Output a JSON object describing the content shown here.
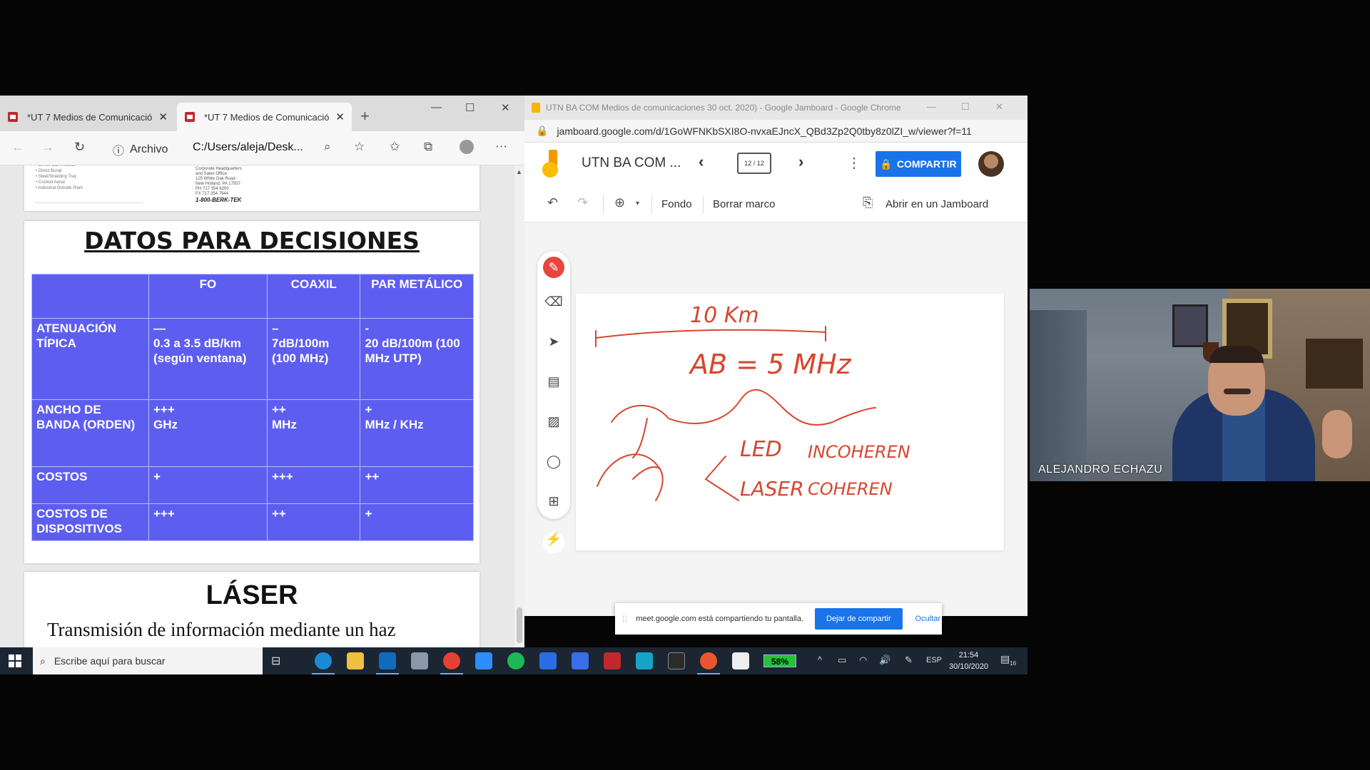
{
  "edge": {
    "tabs": [
      {
        "label": "*UT 7 Medios de Comunicación"
      },
      {
        "label": "*UT 7 Medios de Comunicación"
      }
    ],
    "address_info": "Archivo",
    "address_url": "C:/Users/aleja/Desk...",
    "prev_page": {
      "bullets": "• Dense Ball Modular\n• Direct Burial\n• Steel/Shielding Tray\n• Cocked Aerial\n• Industrial Outside Plant",
      "address": "Corporate Headquarters\nand Sales Office\n125 White Oak Road\nNew Holland, PA 17557\nPH 717 354 6200\nFX 717 354 7944",
      "phone": "1-800-BERK-TEK"
    },
    "slide": {
      "title": "DATOS PARA DECISIONES",
      "columns": [
        "",
        "FO",
        "COAXIL",
        "PAR METÁLICO"
      ],
      "rows": [
        {
          "label": "ATENUACIÓN TÍPICA",
          "fo_mark": "—",
          "fo": "0.3 a 3.5 dB/km (según ventana)",
          "coax_mark": "–",
          "coax": "7dB/100m (100 MHz)",
          "par_mark": "-",
          "par": "20 dB/100m (100 MHz UTP)"
        },
        {
          "label": "ANCHO DE BANDA (ORDEN)",
          "fo_mark": "+++",
          "fo": "GHz",
          "coax_mark": "++",
          "coax": "MHz",
          "par_mark": "+",
          "par": "MHz / KHz"
        },
        {
          "label": "COSTOS",
          "fo_mark": "+",
          "fo": "",
          "coax_mark": "+++",
          "coax": "",
          "par_mark": "++",
          "par": ""
        },
        {
          "label": "COSTOS DE DISPOSITIVOS",
          "fo_mark": "+++",
          "fo": "",
          "coax_mark": "++",
          "coax": "",
          "par_mark": "+",
          "par": ""
        }
      ]
    },
    "next_page": {
      "title": "LÁSER",
      "text": "Transmisión de información mediante un haz"
    }
  },
  "taskbar": {
    "search_placeholder": "Escribe aquí para buscar",
    "battery": "58%",
    "language": "ESP",
    "time": "21:54",
    "date": "30/10/2020",
    "notifications": "16"
  },
  "chrome": {
    "window_title": "UTN BA COM Medios de comunicaciones 30 oct. 2020) - Google Jamboard - Google Chrome",
    "url": "jamboard.google.com/d/1GoWFNKbSXI8O-nvxaEJncX_QBd3Zp2Q0tby8z0lZI_w/viewer?f=11",
    "jam_title": "UTN BA COM ...",
    "frame_counter": "12 / 12",
    "share_label": "COMPARTIR",
    "toolbar": {
      "background_label": "Fondo",
      "clear_label": "Borrar marco",
      "open_label": "Abrir en un Jamboard"
    },
    "board": {
      "distance": "10 Km",
      "bandwidth": "AB = 5 MHz",
      "led": "LED",
      "incoherent": "INCOHEREN",
      "laser": "LASER",
      "coherent": "COHEREN",
      "ink_color": "#d7462f"
    }
  },
  "share_notice": {
    "text": "meet.google.com está compartiendo tu pantalla.",
    "stop_label": "Dejar de compartir",
    "hide_label": "Ocultar"
  },
  "webcam": {
    "participant_name": "ALEJANDRO ECHAZU"
  }
}
